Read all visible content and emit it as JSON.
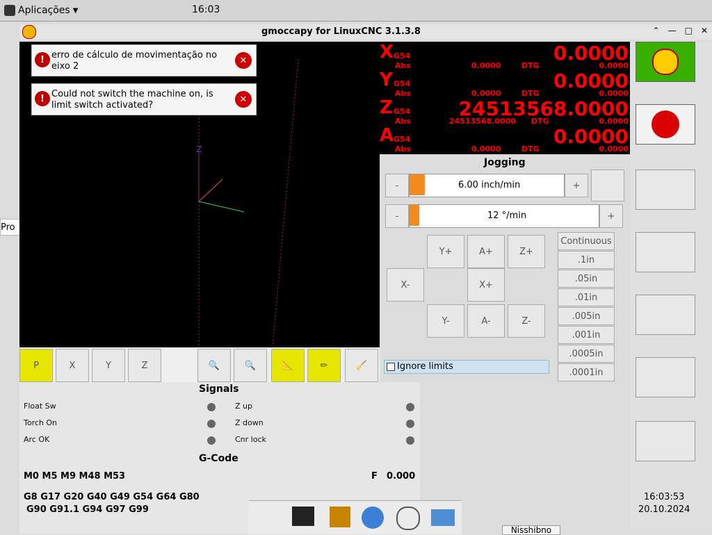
{
  "taskbar": {
    "app_menu": "Aplicações",
    "clock": "16:03"
  },
  "window": {
    "title": "gmoccapy for LinuxCNC  3.1.3.8"
  },
  "left_stub": {
    "text": "Pro"
  },
  "alarms": [
    {
      "text": "erro de cálculo de movimentação no eixo 2"
    },
    {
      "text": "Could not switch the machine on, is limit switch activated?"
    }
  ],
  "preview": {
    "axis_z": "Z"
  },
  "dro": {
    "rows": [
      {
        "axis": "X",
        "cs": "G54",
        "val": "0.0000",
        "abs": "0.0000",
        "dtg": "0.0000"
      },
      {
        "axis": "Y",
        "cs": "G54",
        "val": "0.0000",
        "abs": "0.0000",
        "dtg": "0.0000"
      },
      {
        "axis": "Z",
        "cs": "G54",
        "val": "24513568.0000",
        "abs": "24513568.0000",
        "dtg": "0.0000"
      },
      {
        "axis": "A",
        "cs": "G54",
        "val": "0.0000",
        "abs": "0.0000",
        "dtg": "0.0000"
      }
    ],
    "abs_label": "Abs",
    "dtg_label": "DTG"
  },
  "jogging": {
    "title": "Jogging",
    "linear_speed": "6.00 inch/min",
    "angular_speed": "12 °/min",
    "buttons": {
      "yplus": "Y+",
      "aplus": "A+",
      "zplus": "Z+",
      "xminus": "X-",
      "xplus": "X+",
      "yminus": "Y-",
      "aminus": "A-",
      "zminus": "Z-"
    },
    "increments": [
      "Continuous",
      ".1in",
      ".05in",
      ".01in",
      ".005in",
      ".001in",
      ".0005in",
      ".0001in"
    ],
    "ignore_limits": "Ignore limits",
    "minus": "-",
    "plus": "+"
  },
  "signals": {
    "title": "Signals",
    "left": [
      "Float Sw",
      "Torch On",
      "Arc OK"
    ],
    "right": [
      "Z up",
      "Z down",
      "Cnr lock"
    ]
  },
  "gcode": {
    "title": "G-Code",
    "mcodes": "M0 M5 M9 M48 M53",
    "feed_label": "F",
    "feed_value": "0.000",
    "gcodes_line1": "G8 G17 G20 G40 G49 G54 G64 G80",
    "gcodes_line2": "G90 G91.1 G94 G97 G99"
  },
  "statusbar": {
    "time": "16:03:53",
    "date": "20.10.2024",
    "button_label": "Nisshibno"
  }
}
